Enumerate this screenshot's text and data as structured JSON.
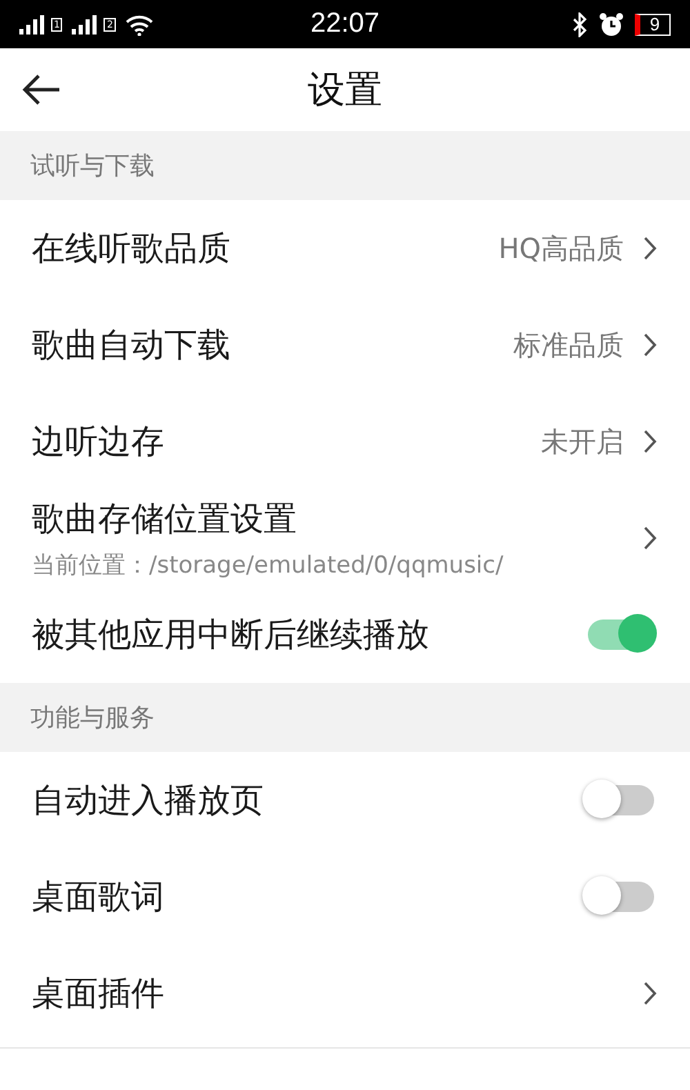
{
  "status_bar": {
    "sims": [
      "1",
      "2"
    ],
    "time": "22:07",
    "battery": "9"
  },
  "header": {
    "title": "设置"
  },
  "sections": [
    {
      "title": "试听与下载",
      "items": [
        {
          "kind": "value",
          "label": "在线听歌品质",
          "value": "HQ高品质"
        },
        {
          "kind": "value",
          "label": "歌曲自动下载",
          "value": "标准品质"
        },
        {
          "kind": "value",
          "label": "边听边存",
          "value": "未开启"
        },
        {
          "kind": "path",
          "label": "歌曲存储位置设置",
          "subtitle": "当前位置：/storage/emulated/0/qqmusic/"
        },
        {
          "kind": "toggle",
          "label": "被其他应用中断后继续播放",
          "on": true
        }
      ]
    },
    {
      "title": "功能与服务",
      "items": [
        {
          "kind": "toggle",
          "label": "自动进入播放页",
          "on": false
        },
        {
          "kind": "toggle",
          "label": "桌面歌词",
          "on": false
        },
        {
          "kind": "link",
          "label": "桌面插件"
        }
      ]
    }
  ]
}
